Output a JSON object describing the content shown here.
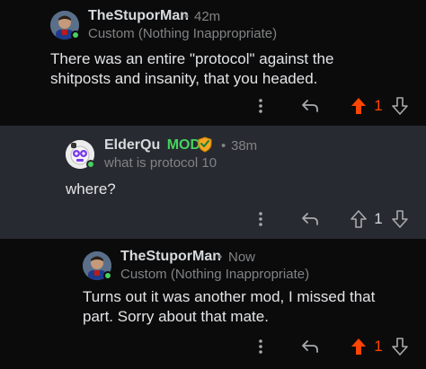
{
  "comments": [
    {
      "username": "TheStuporMan",
      "time": "42m",
      "flair": "Custom (Nothing Inappropriate)",
      "text": "There was an entire \"protocol\" against the shitposts and insanity, that you headed.",
      "vote_count": "1",
      "upvoted": true
    },
    {
      "username": "ElderQu",
      "mod_tag": "MOD",
      "time": "38m",
      "flair": "what is protocol 10",
      "text": "where?",
      "vote_count": "1",
      "upvoted": false
    },
    {
      "username": "TheStuporMan",
      "time": "Now",
      "flair": "Custom (Nothing Inappropriate)",
      "text": "Turns out it was another mod, I missed that part. Sorry about that mate.",
      "vote_count": "1",
      "upvoted": true
    }
  ],
  "colors": {
    "upvote_active": "#ff4500",
    "online": "#46d160",
    "mod": "#46d160",
    "highlight_bg": "#272a30"
  },
  "separator": "•"
}
